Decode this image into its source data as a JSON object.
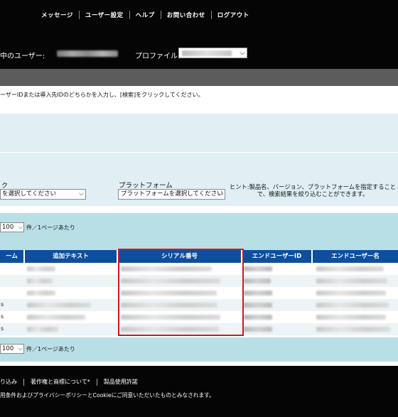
{
  "topnav": {
    "messages": "メッセージ",
    "user_settings": "ユーザー設定",
    "help": "ヘルプ",
    "contact": "お問い合わせ",
    "logout": "ログアウト"
  },
  "user_bar": {
    "current_user_label": "中のユーザー:",
    "profile_label": "プロファイル:"
  },
  "instruction": "ーザーIDまたは導入先IDのどちらかを入力し、[検索]をクリックしてください。",
  "filters": {
    "product_label_fragment": "ク",
    "product_select": "を選択してください",
    "platform_label": "プラットフォーム",
    "platform_select": "プラットフォームを選択してください",
    "hint": "ヒント:製品名、バージョン、プラットフォームを指定すること\nで、検索結果を絞り込むことができます。"
  },
  "pager": {
    "per_page_value": "100",
    "per_page_label": "件／1ページあたり"
  },
  "table": {
    "columns": [
      "ーム",
      "追加テキスト",
      "シリアル番号",
      "エンドユーザーID",
      "エンドユーザー名"
    ],
    "row_fragments": [
      "",
      "",
      "",
      "s",
      "s",
      "s"
    ]
  },
  "footer": {
    "links": [
      "り込み",
      "著作権と商標について*",
      "製品使用許諾"
    ],
    "note": "用条件およびプライバシーポリシーとCookieにご同意いただいたものとみなされます。"
  },
  "colors": {
    "header_bg": "#050505",
    "table_header": "#0e4e9e",
    "highlight": "#d0191f",
    "panel_light": "#dfeff4",
    "pager_bg": "#b9dfe6"
  }
}
